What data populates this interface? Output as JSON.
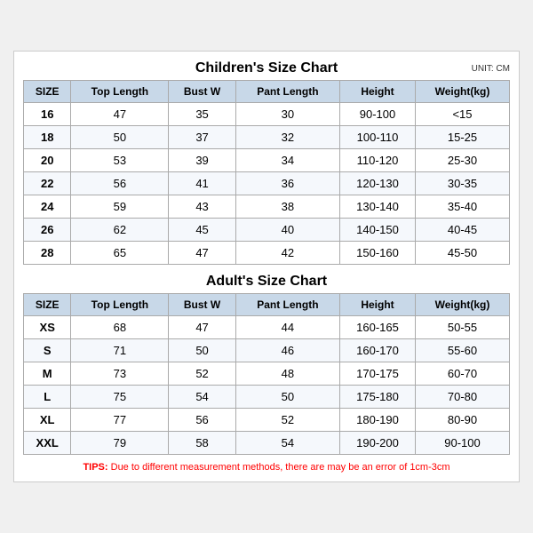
{
  "children": {
    "title": "Children's Size Chart",
    "unit": "UNIT: CM",
    "headers": [
      "SIZE",
      "Top Length",
      "Bust W",
      "Pant Length",
      "Height",
      "Weight(kg)"
    ],
    "rows": [
      [
        "16",
        "47",
        "35",
        "30",
        "90-100",
        "<15"
      ],
      [
        "18",
        "50",
        "37",
        "32",
        "100-110",
        "15-25"
      ],
      [
        "20",
        "53",
        "39",
        "34",
        "110-120",
        "25-30"
      ],
      [
        "22",
        "56",
        "41",
        "36",
        "120-130",
        "30-35"
      ],
      [
        "24",
        "59",
        "43",
        "38",
        "130-140",
        "35-40"
      ],
      [
        "26",
        "62",
        "45",
        "40",
        "140-150",
        "40-45"
      ],
      [
        "28",
        "65",
        "47",
        "42",
        "150-160",
        "45-50"
      ]
    ]
  },
  "adults": {
    "title": "Adult's Size Chart",
    "headers": [
      "SIZE",
      "Top Length",
      "Bust W",
      "Pant Length",
      "Height",
      "Weight(kg)"
    ],
    "rows": [
      [
        "XS",
        "68",
        "47",
        "44",
        "160-165",
        "50-55"
      ],
      [
        "S",
        "71",
        "50",
        "46",
        "160-170",
        "55-60"
      ],
      [
        "M",
        "73",
        "52",
        "48",
        "170-175",
        "60-70"
      ],
      [
        "L",
        "75",
        "54",
        "50",
        "175-180",
        "70-80"
      ],
      [
        "XL",
        "77",
        "56",
        "52",
        "180-190",
        "80-90"
      ],
      [
        "XXL",
        "79",
        "58",
        "54",
        "190-200",
        "90-100"
      ]
    ]
  },
  "tips": {
    "label": "TIPS:",
    "text": " Due to different measurement methods, there are may be an error of 1cm-3cm"
  }
}
